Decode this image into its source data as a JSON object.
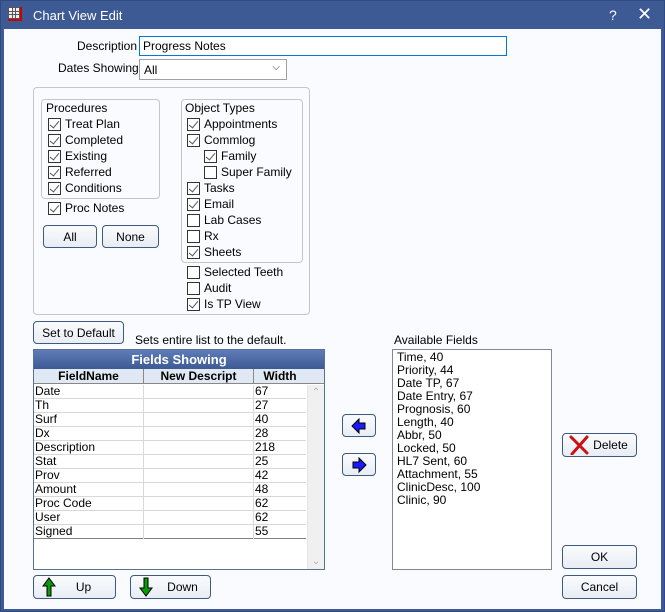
{
  "window": {
    "title": "Chart View Edit",
    "help_glyph": "?",
    "close_glyph": "✕"
  },
  "form": {
    "description_label": "Description",
    "description_value": "Progress Notes",
    "dates_label": "Dates Showing",
    "dates_value": "All",
    "dates_arrow": "⌵"
  },
  "procedures": {
    "title": "Procedures",
    "items": [
      {
        "label": "Treat Plan",
        "checked": true
      },
      {
        "label": "Completed",
        "checked": true
      },
      {
        "label": "Existing",
        "checked": true
      },
      {
        "label": "Referred",
        "checked": true
      },
      {
        "label": "Conditions",
        "checked": true
      }
    ],
    "proc_notes": {
      "label": "Proc Notes",
      "checked": true
    },
    "all_label": "All",
    "none_label": "None"
  },
  "object_types": {
    "title": "Object Types",
    "items": [
      {
        "label": "Appointments",
        "checked": true
      },
      {
        "label": "Commlog",
        "checked": true
      },
      {
        "label": "Family",
        "checked": true
      },
      {
        "label": "Super Family",
        "checked": false
      },
      {
        "label": "Tasks",
        "checked": true
      },
      {
        "label": "Email",
        "checked": true
      },
      {
        "label": "Lab Cases",
        "checked": false
      },
      {
        "label": "Rx",
        "checked": false
      },
      {
        "label": "Sheets",
        "checked": true
      }
    ],
    "extra": [
      {
        "label": "Selected Teeth",
        "checked": false
      },
      {
        "label": "Audit",
        "checked": false
      },
      {
        "label": "Is TP View",
        "checked": true
      }
    ]
  },
  "defaults": {
    "button_label": "Set to Default",
    "hint": "Sets entire list to the default."
  },
  "fields_showing": {
    "title": "Fields Showing",
    "columns": [
      "FieldName",
      "New Descript",
      "Width"
    ],
    "rows": [
      {
        "name": "Date",
        "descript": "",
        "width": "67"
      },
      {
        "name": "Th",
        "descript": "",
        "width": "27"
      },
      {
        "name": "Surf",
        "descript": "",
        "width": "40"
      },
      {
        "name": "Dx",
        "descript": "",
        "width": "28"
      },
      {
        "name": "Description",
        "descript": "",
        "width": "218"
      },
      {
        "name": "Stat",
        "descript": "",
        "width": "25"
      },
      {
        "name": "Prov",
        "descript": "",
        "width": "42"
      },
      {
        "name": "Amount",
        "descript": "",
        "width": "48"
      },
      {
        "name": "Proc Code",
        "descript": "",
        "width": "62"
      },
      {
        "name": "User",
        "descript": "",
        "width": "62"
      },
      {
        "name": "Signed",
        "descript": "",
        "width": "55"
      }
    ],
    "scroll_up": "⌃",
    "scroll_down": "⌄"
  },
  "available": {
    "label": "Available Fields",
    "items": [
      "Time, 40",
      "Priority, 44",
      "Date TP, 67",
      "Date Entry, 67",
      "Prognosis, 60",
      "Length, 40",
      "Abbr, 50",
      "Locked, 50",
      "HL7 Sent, 60",
      "Attachment, 55",
      "ClinicDesc, 100",
      "Clinic, 90"
    ]
  },
  "buttons": {
    "up": "Up",
    "down": "Down",
    "delete": "Delete",
    "ok": "OK",
    "cancel": "Cancel"
  },
  "colors": {
    "titlebar": "#3d5a94",
    "arrow_blue": "#1a1aff",
    "arrow_green": "#0a9a0a",
    "delete_red": "#cc1111"
  }
}
